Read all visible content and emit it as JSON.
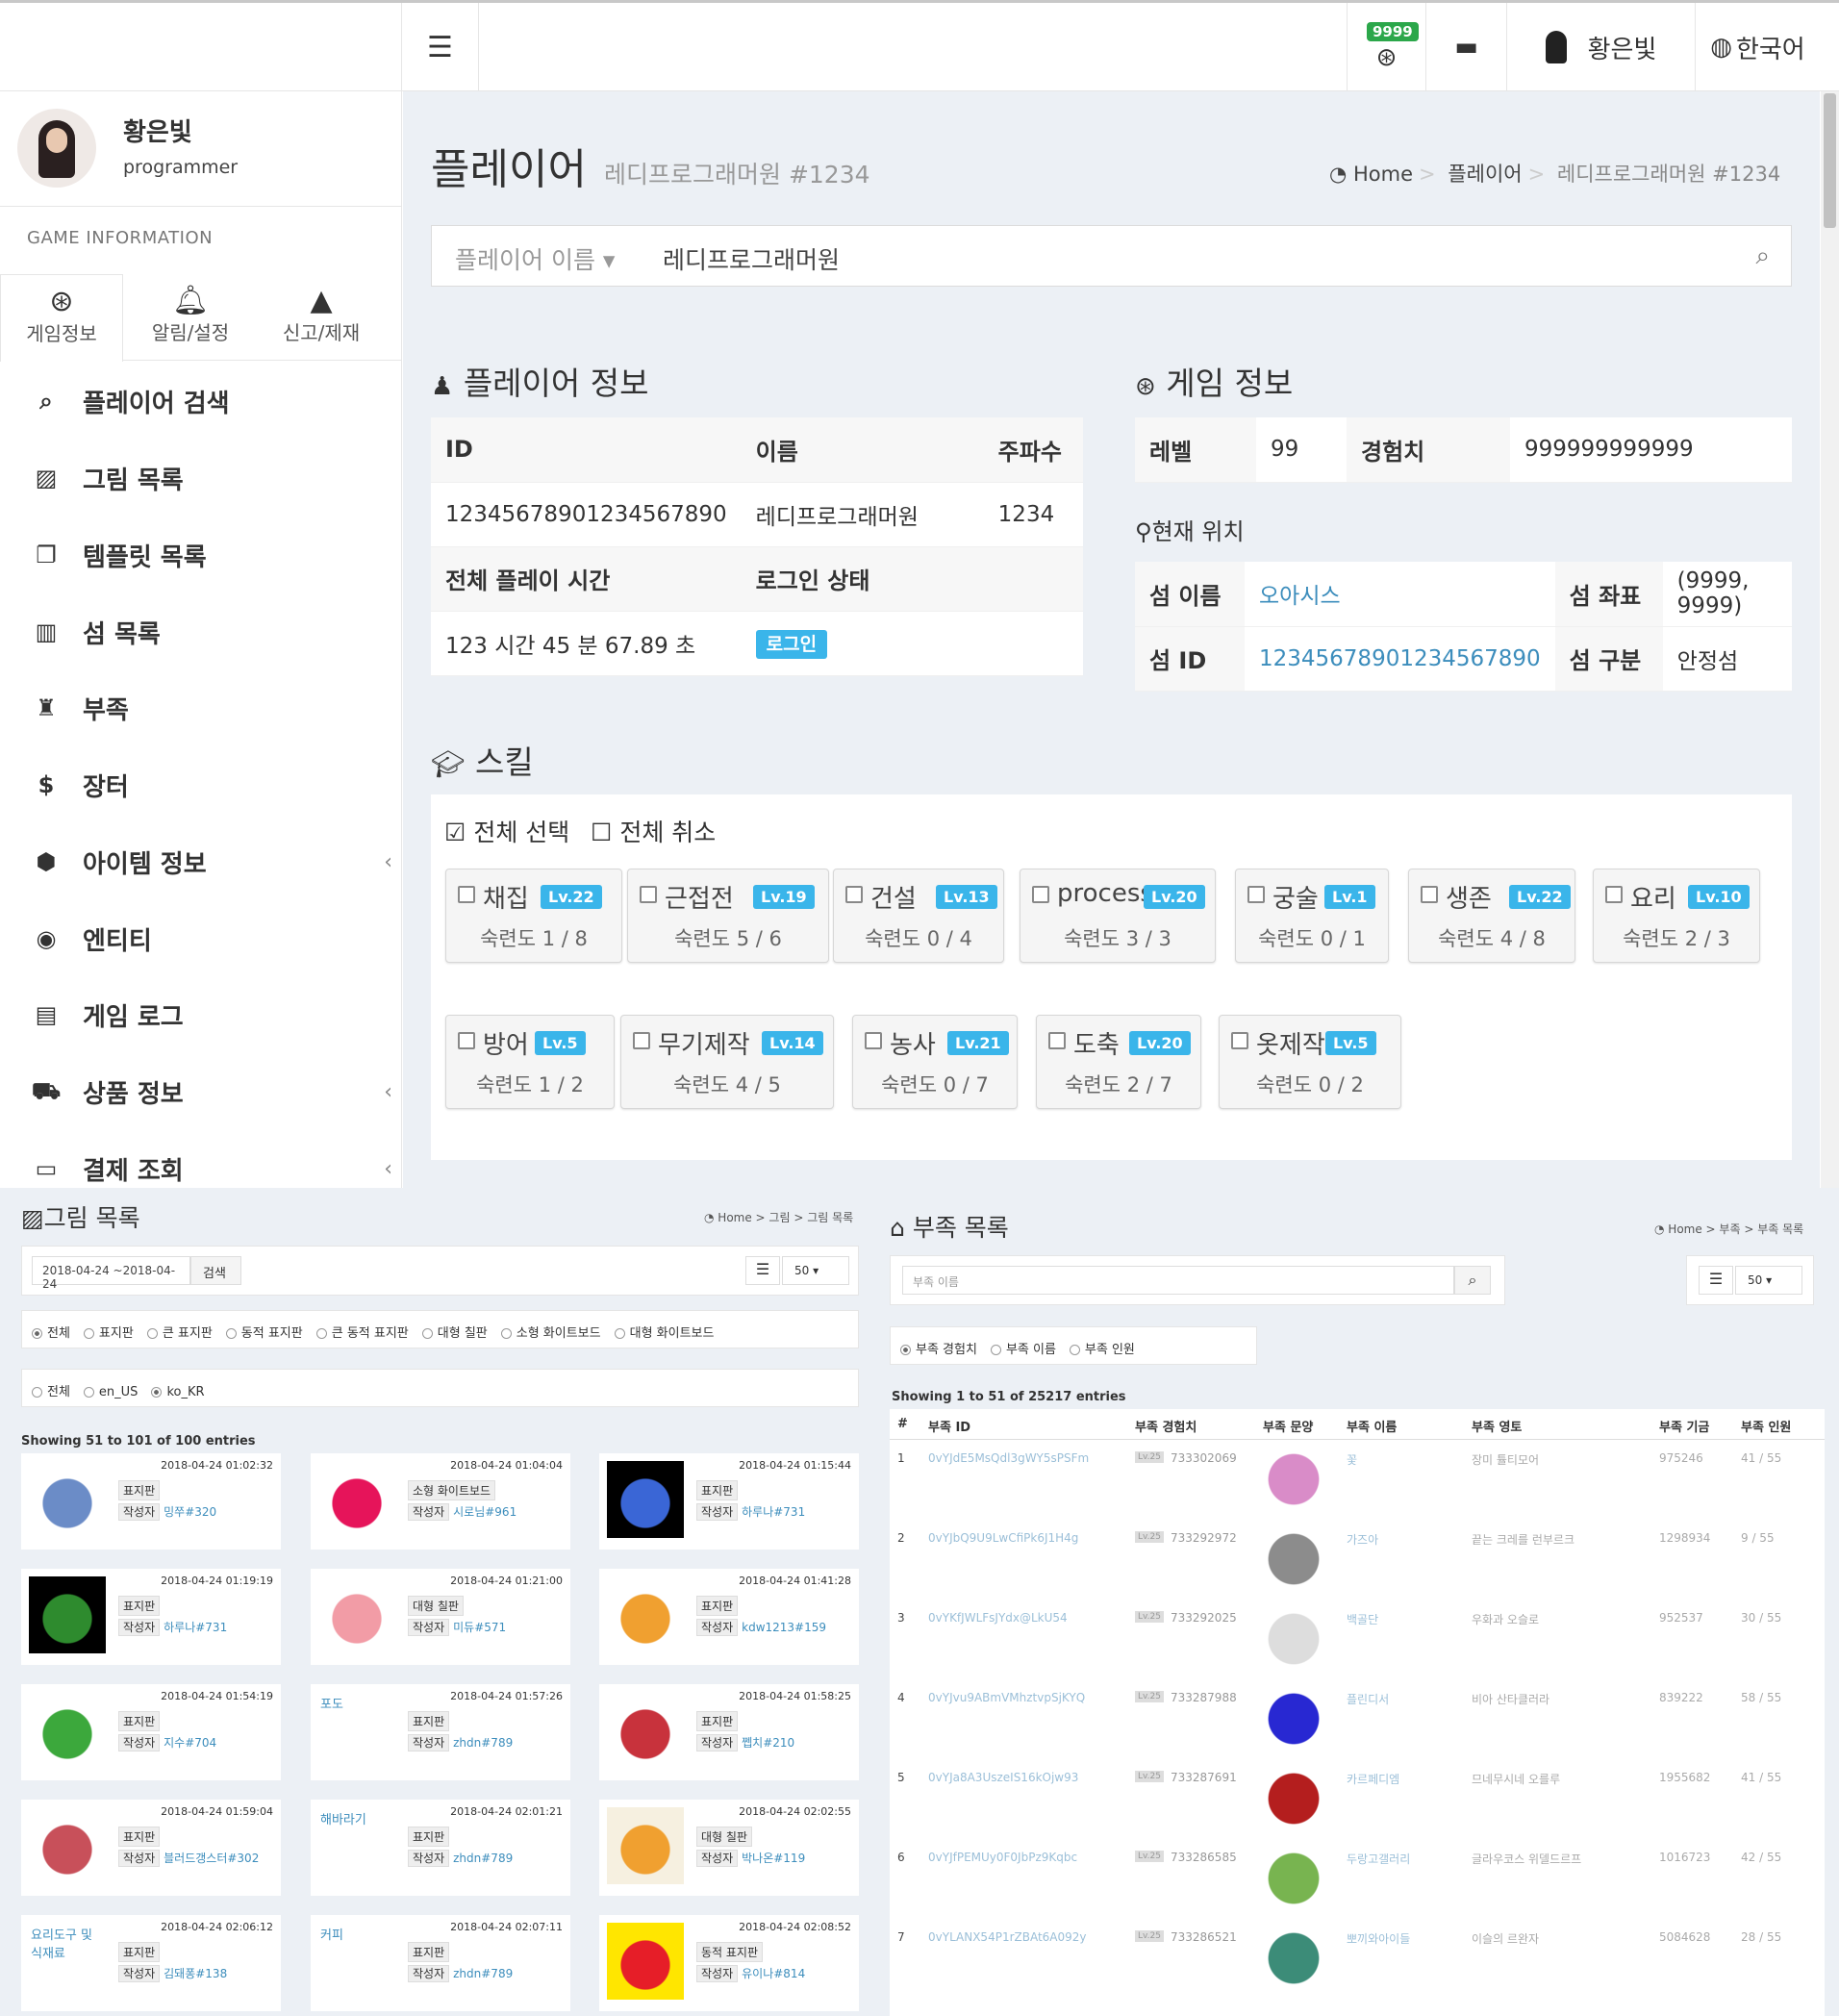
{
  "header": {
    "coins": "9999",
    "user_name": "황은빛",
    "language": "한국어"
  },
  "sidebar": {
    "user_name": "황은빛",
    "user_role": "programmer",
    "section": "GAME INFORMATION",
    "tabs": [
      {
        "icon": "gamepad-icon",
        "label": "게임정보"
      },
      {
        "icon": "bell-icon",
        "label": "알림/설정"
      },
      {
        "icon": "warning-icon",
        "label": "신고/제재"
      }
    ],
    "menu": [
      {
        "icon": "search-icon",
        "label": "플레이어 검색"
      },
      {
        "icon": "image-icon",
        "label": "그림 목록"
      },
      {
        "icon": "copy-icon",
        "label": "템플릿 목록"
      },
      {
        "icon": "map-icon",
        "label": "섬 목록"
      },
      {
        "icon": "trophy-icon",
        "label": "부족"
      },
      {
        "icon": "dollar-icon",
        "label": "장터"
      },
      {
        "icon": "cube-icon",
        "label": "아이템 정보"
      },
      {
        "icon": "target-icon",
        "label": "엔티티"
      },
      {
        "icon": "file-icon",
        "label": "게임 로그"
      },
      {
        "icon": "cart-icon",
        "label": "상품 정보"
      },
      {
        "icon": "money-icon",
        "label": "결제 조회"
      }
    ]
  },
  "page": {
    "title": "플레이어",
    "subtitle": "레디프로그래머원 #1234",
    "breadcrumb": [
      "Home",
      "플레이어",
      "레디프로그래머원 #1234"
    ],
    "search_select": "플레이어 이름",
    "search_value": "레디프로그래머원"
  },
  "player_info": {
    "title": "플레이어 정보",
    "headers": [
      "ID",
      "이름",
      "주파수"
    ],
    "id": "12345678901234567890",
    "name": "레디프로그래머원",
    "freq": "1234",
    "playtime_label": "전체 플레이 시간",
    "login_label": "로그인 상태",
    "playtime": "123 시간 45 분 67.89 초",
    "login_status": "로그인"
  },
  "game_info": {
    "title": "게임 정보",
    "level_label": "레벨",
    "level": "99",
    "exp_label": "경험치",
    "exp": "999999999999"
  },
  "location": {
    "title": "현재 위치",
    "island_name_label": "섬 이름",
    "island_name": "오아시스",
    "coord_label": "섬 좌표",
    "coord": "(9999, 9999)",
    "island_id_label": "섬 ID",
    "island_id": "12345678901234567890",
    "type_label": "섬 구분",
    "type": "안정섬"
  },
  "skills": {
    "title": "스킬",
    "select_all": "전체 선택",
    "deselect_all": "전체 취소",
    "items": [
      {
        "name": "채집",
        "lv": "Lv.22",
        "prof": "숙련도 1 / 8"
      },
      {
        "name": "근접전",
        "lv": "Lv.19",
        "prof": "숙련도 5 / 6"
      },
      {
        "name": "건설",
        "lv": "Lv.13",
        "prof": "숙련도 0 / 4"
      },
      {
        "name": "process",
        "lv": "Lv.20",
        "prof": "숙련도 3 / 3"
      },
      {
        "name": "궁술",
        "lv": "Lv.1",
        "prof": "숙련도 0 / 1"
      },
      {
        "name": "생존",
        "lv": "Lv.22",
        "prof": "숙련도 4 / 8"
      },
      {
        "name": "요리",
        "lv": "Lv.10",
        "prof": "숙련도 2 / 3"
      },
      {
        "name": "방어",
        "lv": "Lv.5",
        "prof": "숙련도 1 / 2"
      },
      {
        "name": "무기제작",
        "lv": "Lv.14",
        "prof": "숙련도 4 / 5"
      },
      {
        "name": "농사",
        "lv": "Lv.21",
        "prof": "숙련도 0 / 7"
      },
      {
        "name": "도축",
        "lv": "Lv.20",
        "prof": "숙련도 2 / 7"
      },
      {
        "name": "옷제작",
        "lv": "Lv.5",
        "prof": "숙련도 0 / 2"
      }
    ]
  },
  "drawings": {
    "title": "그림 목록",
    "breadcrumb": [
      "Home",
      "그림",
      "그림 목록"
    ],
    "date_range": "2018-04-24 ~2018-04-24",
    "search_btn": "검색",
    "page_size": "50",
    "filters": [
      "전체",
      "표지판",
      "큰 표지판",
      "동적 표지판",
      "큰 동적 표지판",
      "대형 칠판",
      "소형 화이트보드",
      "대형 화이트보드"
    ],
    "langs": [
      "전체",
      "en_US",
      "ko_KR"
    ],
    "showing": "Showing 51 to 101 of 100 entries",
    "author_label": "작성자",
    "cards": [
      {
        "date": "2018-04-24 01:02:32",
        "tag": "표지판",
        "author": "밍쭈#320",
        "title": "",
        "color": "#6b8cc7"
      },
      {
        "date": "2018-04-24 01:04:04",
        "tag": "소형 화이트보드",
        "author": "시로님#961",
        "title": "",
        "color": "#e6145a"
      },
      {
        "date": "2018-04-24 01:15:44",
        "tag": "표지판",
        "author": "하루나#731",
        "title": "",
        "color": "#3a66d6"
      },
      {
        "date": "2018-04-24 01:19:19",
        "tag": "표지판",
        "author": "하루나#731",
        "title": "",
        "color": "#2e8b2e"
      },
      {
        "date": "2018-04-24 01:21:00",
        "tag": "대형 칠판",
        "author": "미듀#571",
        "title": "",
        "color": "#f29ca6"
      },
      {
        "date": "2018-04-24 01:41:28",
        "tag": "표지판",
        "author": "kdw1213#159",
        "title": "",
        "color": "#f0a030"
      },
      {
        "date": "2018-04-24 01:54:19",
        "tag": "표지판",
        "author": "지수#704",
        "title": "",
        "color": "#3ca83c"
      },
      {
        "date": "2018-04-24 01:57:26",
        "tag": "표지판",
        "author": "zhdn#789",
        "title": "포도",
        "color": ""
      },
      {
        "date": "2018-04-24 01:58:25",
        "tag": "표지판",
        "author": "쩹치#210",
        "title": "",
        "color": "#c8323c"
      },
      {
        "date": "2018-04-24 01:59:04",
        "tag": "표지판",
        "author": "블러드갱스터#302",
        "title": "",
        "color": "#c8505a"
      },
      {
        "date": "2018-04-24 02:01:21",
        "tag": "표지판",
        "author": "zhdn#789",
        "title": "해바라기",
        "color": ""
      },
      {
        "date": "2018-04-24 02:02:55",
        "tag": "대형 칠판",
        "author": "박나온#119",
        "title": "",
        "color": "#f0a030"
      },
      {
        "date": "2018-04-24 02:06:12",
        "tag": "표지판",
        "author": "김돼퐁#138",
        "title": "요리도구 및 식재료",
        "color": ""
      },
      {
        "date": "2018-04-24 02:07:11",
        "tag": "표지판",
        "author": "zhdn#789",
        "title": "커피",
        "color": ""
      },
      {
        "date": "2018-04-24 02:08:52",
        "tag": "동적 표지판",
        "author": "유이나#814",
        "title": "",
        "color": "#e61e28"
      }
    ]
  },
  "tribes": {
    "title": "부족 목록",
    "breadcrumb": [
      "Home",
      "부족",
      "부족 목록"
    ],
    "search_placeholder": "부족 이름",
    "page_size": "50",
    "sorts": [
      "부족 경험치",
      "부족 이름",
      "부족 인원"
    ],
    "showing": "Showing 1 to 51 of 25217 entries",
    "columns": [
      "#",
      "부족 ID",
      "부족 경험치",
      "부족 문양",
      "부족 이름",
      "부족 영토",
      "부족 기금",
      "부족 인원"
    ],
    "rows": [
      {
        "n": "1",
        "id": "0vYJdE5MsQdl3gWY5sPSFm",
        "lv": "Lv.25",
        "exp": "733302069",
        "name": "꽃",
        "terr": "장미 튤티모어",
        "fund": "975246",
        "mem": "41 / 55",
        "color": "#d98cc8"
      },
      {
        "n": "2",
        "id": "0vYJbQ9U9LwCfiPk6J1H4g",
        "lv": "Lv.25",
        "exp": "733292972",
        "name": "가즈아",
        "terr": "끝는 크레를 런부르크",
        "fund": "1298934",
        "mem": "9 / 55",
        "color": "#8c8c8c"
      },
      {
        "n": "3",
        "id": "0vYKfJWLFsJYdx@LkU54",
        "lv": "Lv.25",
        "exp": "733292025",
        "name": "백골단",
        "terr": "우화과 오슬로",
        "fund": "952537",
        "mem": "30 / 55",
        "color": "#dddddd"
      },
      {
        "n": "4",
        "id": "0vYJvu9ABmVMhztvpSjKYQ",
        "lv": "Lv.25",
        "exp": "733287988",
        "name": "플린디서",
        "terr": "비아 산타클러라",
        "fund": "839222",
        "mem": "58 / 55",
        "color": "#2828d2"
      },
      {
        "n": "5",
        "id": "0vYJa8A3UszeIS16kOjw93",
        "lv": "Lv.25",
        "exp": "733287691",
        "name": "카르페디엠",
        "terr": "므네무시네 오를루",
        "fund": "1955682",
        "mem": "41 / 55",
        "color": "#b41e1e"
      },
      {
        "n": "6",
        "id": "0vYJfPEMUy0F0JbPz9Kqbc",
        "lv": "Lv.25",
        "exp": "733286585",
        "name": "두랑고갤러리",
        "terr": "글라우코스 위델드르프",
        "fund": "1016723",
        "mem": "42 / 55",
        "color": "#78b450"
      },
      {
        "n": "7",
        "id": "0vYLANX54P1rZBAt6A092y",
        "lv": "Lv.25",
        "exp": "733286521",
        "name": "뽀끼와아이들",
        "terr": "이슬의 르완자",
        "fund": "5084628",
        "mem": "28 / 55",
        "color": "#3c8c78"
      }
    ]
  },
  "colors": {
    "accent": "#3ab5ea",
    "link": "#3c8dbc",
    "bg": "#ecf0f5",
    "coin_badge": "#2ba74a"
  }
}
